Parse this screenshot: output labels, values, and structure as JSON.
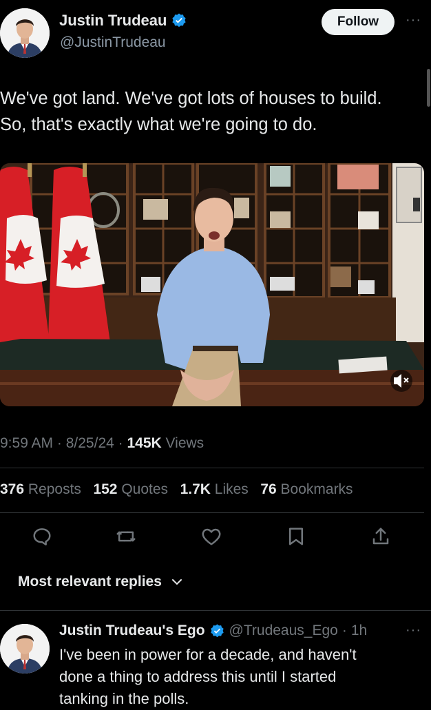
{
  "author": {
    "name": "Justin Trudeau",
    "handle": "@JustinTrudeau",
    "follow_label": "Follow"
  },
  "tweet": {
    "line1": "We've got land. We've got lots of houses to build.",
    "line2": "So, that's exactly what we're going to do.",
    "time": "9:59 AM",
    "date": "8/25/24",
    "views_count": "145K",
    "views_label": "Views"
  },
  "stats": {
    "reposts_count": "376",
    "reposts_label": "Reposts",
    "quotes_count": "152",
    "quotes_label": "Quotes",
    "likes_count": "1.7K",
    "likes_label": "Likes",
    "bookmarks_count": "76",
    "bookmarks_label": "Bookmarks"
  },
  "replies_header": "Most relevant replies",
  "reply": {
    "name": "Justin Trudeau's Ego",
    "handle": "@Trudeaus_Ego",
    "time": "1h",
    "line1": "I've been in power for a decade, and haven't",
    "line2": "done a thing to address this until I started",
    "line3": "tanking in the polls."
  },
  "icons": {
    "verified": "verified-badge-icon",
    "more": "more-horizontal-icon",
    "mute": "mute-icon",
    "reply": "reply-icon",
    "repost": "repost-icon",
    "like": "heart-icon",
    "bookmark": "bookmark-icon",
    "share": "share-icon",
    "chevron": "chevron-down-icon"
  },
  "colors": {
    "background": "#000000",
    "text": "#e7e9ea",
    "secondary": "#71767b",
    "verified": "#1d9bf0",
    "divider": "#2f3336"
  }
}
